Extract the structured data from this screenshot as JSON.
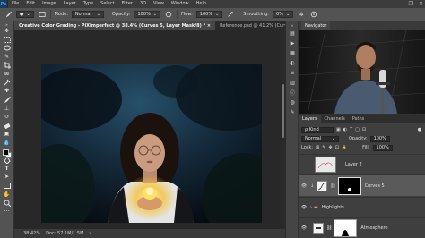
{
  "app_logo": "Ps",
  "menu": [
    "File",
    "Edit",
    "Image",
    "Layer",
    "Type",
    "Select",
    "Filter",
    "3D",
    "View",
    "Window",
    "Help"
  ],
  "window_controls": [
    "—",
    "❐",
    "✕"
  ],
  "options": {
    "mode_label": "Mode:",
    "mode_value": "Normal",
    "opacity_label": "Opacity:",
    "opacity_value": "100%",
    "flow_label": "Flow:",
    "flow_value": "100%",
    "smoothing_label": "Smoothing:",
    "smoothing_value": "0%"
  },
  "tabs": [
    {
      "label": "Creative Color Grading - PiXimperfect @ 38.4% (Curves 5, Layer Mask/8) *  ×",
      "active": true
    },
    {
      "label": "Reference.psd @ 41.2% (Curves ...",
      "active": false
    }
  ],
  "status": {
    "zoom": "38.42%",
    "doc": "Doc: 57.1M/1.5M",
    "arrow": "›"
  },
  "navigator": {
    "title": "Navigator"
  },
  "layers_panel": {
    "tabs": [
      "Layers",
      "Channels",
      "Paths"
    ],
    "kind_label": "ρ Kind",
    "blend_mode": "Normal",
    "opacity_label": "Opacity:",
    "opacity_value": "100%",
    "lock_label": "Lock:",
    "fill_label": "Fill:",
    "fill_value": "100%",
    "layers": [
      {
        "name": "Layer 2"
      },
      {
        "name": "Curves 5"
      },
      {
        "name": "Highlights"
      },
      {
        "name": "Atmosphere"
      }
    ]
  },
  "colors": {
    "accent": "#31a8ff",
    "panel": "#535353",
    "dark": "#282828"
  }
}
